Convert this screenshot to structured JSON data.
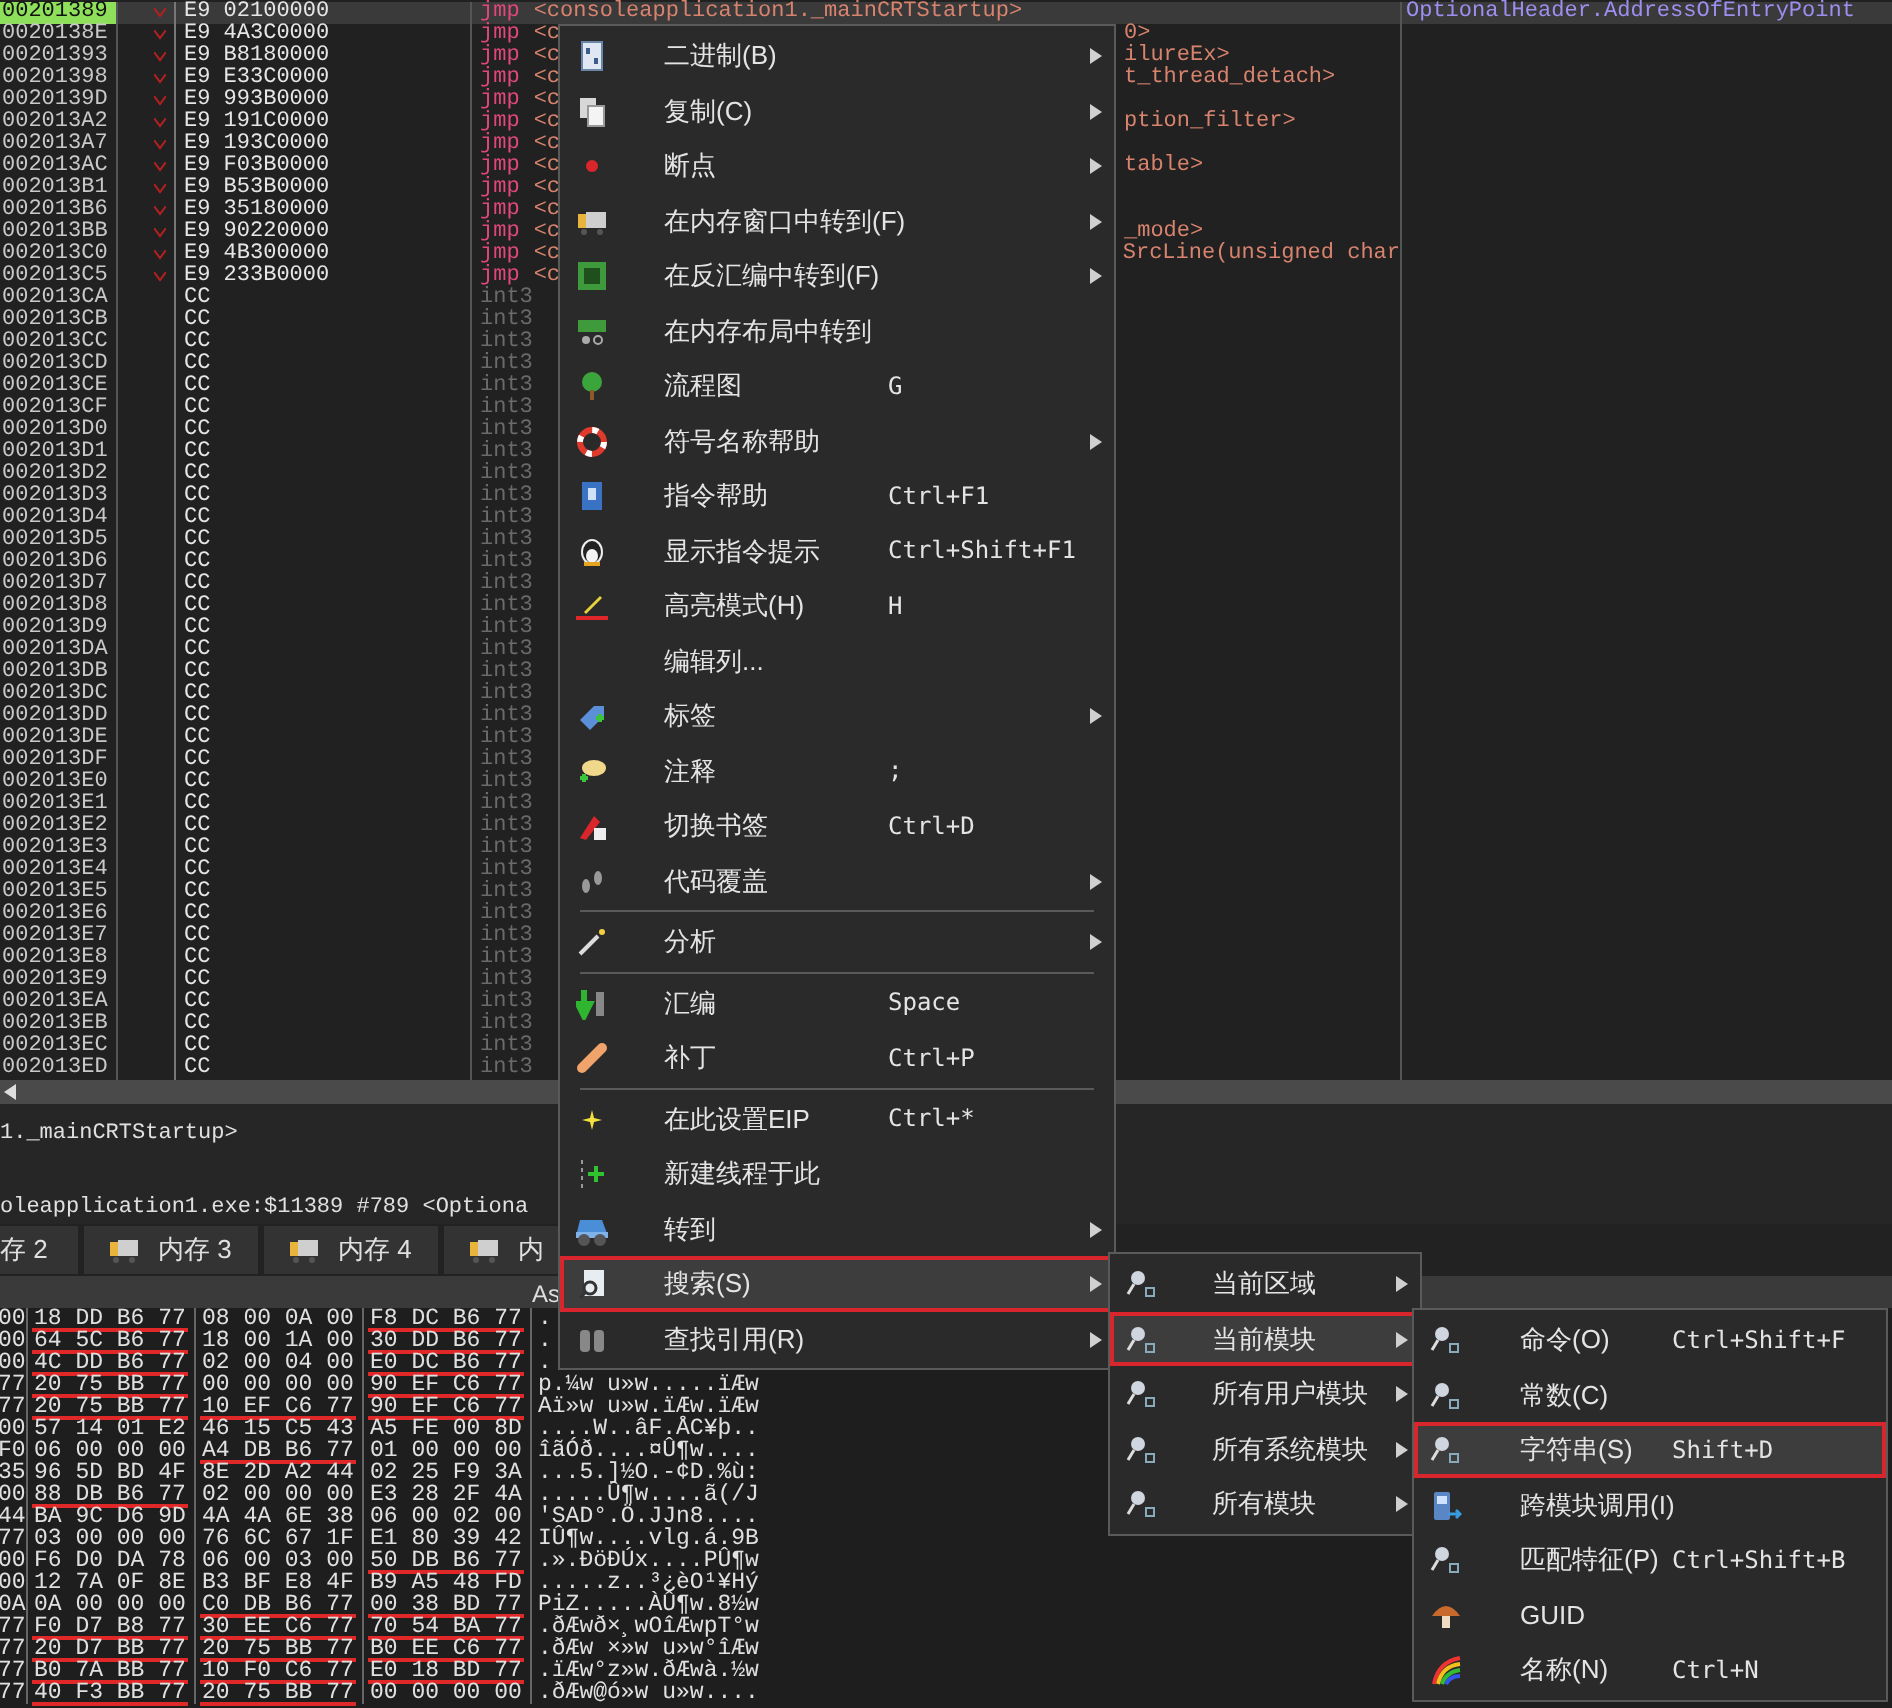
{
  "disassembly": {
    "rows": [
      {
        "kind": "jmp",
        "selected": true,
        "address": "00201389",
        "bytes": "E9 02100000",
        "mnemonic": "jmp",
        "operand": "<consoleapplication1._mainCRTStartup>",
        "comment": "OptionalHeader.AddressOfEntryPoint"
      },
      {
        "kind": "jmp",
        "selected": false,
        "address": "0020138E",
        "bytes": "E9 4A3C0000",
        "mnemonic": "jmp",
        "operand": "<c",
        "operand_tail": "0>"
      },
      {
        "kind": "jmp",
        "selected": false,
        "address": "00201393",
        "bytes": "E9 B8180000",
        "mnemonic": "jmp",
        "operand": "<c",
        "operand_tail": "ilureEx>"
      },
      {
        "kind": "jmp",
        "selected": false,
        "address": "00201398",
        "bytes": "E9 E33C0000",
        "mnemonic": "jmp",
        "operand": "<c",
        "operand_tail": "t_thread_detach>"
      },
      {
        "kind": "jmp",
        "selected": false,
        "address": "0020139D",
        "bytes": "E9 993B0000",
        "mnemonic": "jmp",
        "operand": "<c"
      },
      {
        "kind": "jmp",
        "selected": false,
        "address": "002013A2",
        "bytes": "E9 191C0000",
        "mnemonic": "jmp",
        "operand": "<c",
        "operand_tail": "ption_filter>"
      },
      {
        "kind": "jmp",
        "selected": false,
        "address": "002013A7",
        "bytes": "E9 193C0000",
        "mnemonic": "jmp",
        "operand": "<c"
      },
      {
        "kind": "jmp",
        "selected": false,
        "address": "002013AC",
        "bytes": "E9 F03B0000",
        "mnemonic": "jmp",
        "operand": "<c",
        "operand_tail": "table>"
      },
      {
        "kind": "jmp",
        "selected": false,
        "address": "002013B1",
        "bytes": "E9 B53B0000",
        "mnemonic": "jmp",
        "operand": "<c"
      },
      {
        "kind": "jmp",
        "selected": false,
        "address": "002013B6",
        "bytes": "E9 35180000",
        "mnemonic": "jmp",
        "operand": "<c"
      },
      {
        "kind": "jmp",
        "selected": false,
        "address": "002013BB",
        "bytes": "E9 90220000",
        "mnemonic": "jmp",
        "operand": "<c",
        "operand_tail": "_mode>"
      },
      {
        "kind": "jmp",
        "selected": false,
        "address": "002013C0",
        "bytes": "E9 4B300000",
        "mnemonic": "jmp",
        "operand": "<c",
        "operand_tail": "SrcLine(unsigned char"
      },
      {
        "kind": "jmp",
        "selected": false,
        "address": "002013C5",
        "bytes": "E9 233B0000",
        "mnemonic": "jmp",
        "operand": "<c"
      },
      {
        "kind": "int3",
        "selected": false,
        "address": "002013CA",
        "bytes": "CC",
        "mnemonic": "int3"
      },
      {
        "kind": "int3",
        "selected": false,
        "address": "002013CB",
        "bytes": "CC",
        "mnemonic": "int3"
      },
      {
        "kind": "int3",
        "selected": false,
        "address": "002013CC",
        "bytes": "CC",
        "mnemonic": "int3"
      },
      {
        "kind": "int3",
        "selected": false,
        "address": "002013CD",
        "bytes": "CC",
        "mnemonic": "int3"
      },
      {
        "kind": "int3",
        "selected": false,
        "address": "002013CE",
        "bytes": "CC",
        "mnemonic": "int3"
      },
      {
        "kind": "int3",
        "selected": false,
        "address": "002013CF",
        "bytes": "CC",
        "mnemonic": "int3"
      },
      {
        "kind": "int3",
        "selected": false,
        "address": "002013D0",
        "bytes": "CC",
        "mnemonic": "int3"
      },
      {
        "kind": "int3",
        "selected": false,
        "address": "002013D1",
        "bytes": "CC",
        "mnemonic": "int3"
      },
      {
        "kind": "int3",
        "selected": false,
        "address": "002013D2",
        "bytes": "CC",
        "mnemonic": "int3"
      },
      {
        "kind": "int3",
        "selected": false,
        "address": "002013D3",
        "bytes": "CC",
        "mnemonic": "int3"
      },
      {
        "kind": "int3",
        "selected": false,
        "address": "002013D4",
        "bytes": "CC",
        "mnemonic": "int3"
      },
      {
        "kind": "int3",
        "selected": false,
        "address": "002013D5",
        "bytes": "CC",
        "mnemonic": "int3"
      },
      {
        "kind": "int3",
        "selected": false,
        "address": "002013D6",
        "bytes": "CC",
        "mnemonic": "int3"
      },
      {
        "kind": "int3",
        "selected": false,
        "address": "002013D7",
        "bytes": "CC",
        "mnemonic": "int3"
      },
      {
        "kind": "int3",
        "selected": false,
        "address": "002013D8",
        "bytes": "CC",
        "mnemonic": "int3"
      },
      {
        "kind": "int3",
        "selected": false,
        "address": "002013D9",
        "bytes": "CC",
        "mnemonic": "int3"
      },
      {
        "kind": "int3",
        "selected": false,
        "address": "002013DA",
        "bytes": "CC",
        "mnemonic": "int3"
      },
      {
        "kind": "int3",
        "selected": false,
        "address": "002013DB",
        "bytes": "CC",
        "mnemonic": "int3"
      },
      {
        "kind": "int3",
        "selected": false,
        "address": "002013DC",
        "bytes": "CC",
        "mnemonic": "int3"
      },
      {
        "kind": "int3",
        "selected": false,
        "address": "002013DD",
        "bytes": "CC",
        "mnemonic": "int3"
      },
      {
        "kind": "int3",
        "selected": false,
        "address": "002013DE",
        "bytes": "CC",
        "mnemonic": "int3"
      },
      {
        "kind": "int3",
        "selected": false,
        "address": "002013DF",
        "bytes": "CC",
        "mnemonic": "int3"
      },
      {
        "kind": "int3",
        "selected": false,
        "address": "002013E0",
        "bytes": "CC",
        "mnemonic": "int3"
      },
      {
        "kind": "int3",
        "selected": false,
        "address": "002013E1",
        "bytes": "CC",
        "mnemonic": "int3"
      },
      {
        "kind": "int3",
        "selected": false,
        "address": "002013E2",
        "bytes": "CC",
        "mnemonic": "int3"
      },
      {
        "kind": "int3",
        "selected": false,
        "address": "002013E3",
        "bytes": "CC",
        "mnemonic": "int3"
      },
      {
        "kind": "int3",
        "selected": false,
        "address": "002013E4",
        "bytes": "CC",
        "mnemonic": "int3"
      },
      {
        "kind": "int3",
        "selected": false,
        "address": "002013E5",
        "bytes": "CC",
        "mnemonic": "int3"
      },
      {
        "kind": "int3",
        "selected": false,
        "address": "002013E6",
        "bytes": "CC",
        "mnemonic": "int3"
      },
      {
        "kind": "int3",
        "selected": false,
        "address": "002013E7",
        "bytes": "CC",
        "mnemonic": "int3"
      },
      {
        "kind": "int3",
        "selected": false,
        "address": "002013E8",
        "bytes": "CC",
        "mnemonic": "int3"
      },
      {
        "kind": "int3",
        "selected": false,
        "address": "002013E9",
        "bytes": "CC",
        "mnemonic": "int3"
      },
      {
        "kind": "int3",
        "selected": false,
        "address": "002013EA",
        "bytes": "CC",
        "mnemonic": "int3"
      },
      {
        "kind": "int3",
        "selected": false,
        "address": "002013EB",
        "bytes": "CC",
        "mnemonic": "int3"
      },
      {
        "kind": "int3",
        "selected": false,
        "address": "002013EC",
        "bytes": "CC",
        "mnemonic": "int3"
      },
      {
        "kind": "int3",
        "selected": false,
        "address": "002013ED",
        "bytes": "CC",
        "mnemonic": "int3"
      }
    ]
  },
  "info_lines": [
    "1._mainCRTStartup>",
    "oleapplication1.exe:$11389 #789 <Optiona"
  ],
  "memory_tabs": [
    {
      "label": "存 2",
      "selected": false
    },
    {
      "label": "内存 3",
      "selected": false
    },
    {
      "label": "内存 4",
      "selected": false
    },
    {
      "label": "内",
      "selected": false
    }
  ],
  "dump": {
    "ascii_header": "As",
    "rows": [
      {
        "edge": "00",
        "groups": [
          {
            "bytes": "18 DD B6 77",
            "pointer": true
          },
          {
            "bytes": "08 00 0A 00",
            "pointer": false
          },
          {
            "bytes": "F8 DC B6 77",
            "pointer": true
          }
        ],
        "ascii": "."
      },
      {
        "edge": "00",
        "groups": [
          {
            "bytes": "64 5C B6 77",
            "pointer": true
          },
          {
            "bytes": "18 00 1A 00",
            "pointer": false
          },
          {
            "bytes": "30 DD B6 77",
            "pointer": true
          }
        ],
        "ascii": "."
      },
      {
        "edge": "00",
        "groups": [
          {
            "bytes": "4C DD B6 77",
            "pointer": true
          },
          {
            "bytes": "02 00 04 00",
            "pointer": false
          },
          {
            "bytes": "E0 DC B6 77",
            "pointer": true
          }
        ],
        "ascii": "."
      },
      {
        "edge": "77",
        "groups": [
          {
            "bytes": "20 75 BB 77",
            "pointer": true
          },
          {
            "bytes": "00 00 00 00",
            "pointer": false
          },
          {
            "bytes": "90 EF C6 77",
            "pointer": true
          }
        ],
        "ascii": "p.¼w u»w.....ïÆw"
      },
      {
        "edge": "77",
        "groups": [
          {
            "bytes": "20 75 BB 77",
            "pointer": true
          },
          {
            "bytes": "10 EF C6 77",
            "pointer": true
          },
          {
            "bytes": "90 EF C6 77",
            "pointer": true
          }
        ],
        "ascii": "Aï»w u»w.ïÆw.ïÆw"
      },
      {
        "edge": "00",
        "groups": [
          {
            "bytes": "57 14 01 E2",
            "pointer": false
          },
          {
            "bytes": "46 15 C5 43",
            "pointer": false
          },
          {
            "bytes": "A5 FE 00 8D",
            "pointer": false
          }
        ],
        "ascii": "....W..âF.ÅC¥þ.."
      },
      {
        "edge": "F0",
        "groups": [
          {
            "bytes": "06 00 00 00",
            "pointer": false
          },
          {
            "bytes": "A4 DB B6 77",
            "pointer": true
          },
          {
            "bytes": "01 00 00 00",
            "pointer": false
          }
        ],
        "ascii": "îãÓð....¤Û¶w...."
      },
      {
        "edge": "35",
        "groups": [
          {
            "bytes": "96 5D BD 4F",
            "pointer": false
          },
          {
            "bytes": "8E 2D A2 44",
            "pointer": false
          },
          {
            "bytes": "02 25 F9 3A",
            "pointer": false
          }
        ],
        "ascii": "...5.]½O.-¢D.%ù:"
      },
      {
        "edge": "00",
        "groups": [
          {
            "bytes": "88 DB B6 77",
            "pointer": true
          },
          {
            "bytes": "02 00 00 00",
            "pointer": false
          },
          {
            "bytes": "E3 28 2F 4A",
            "pointer": false
          }
        ],
        "ascii": ".....Û¶w....ã(/J"
      },
      {
        "edge": "44",
        "groups": [
          {
            "bytes": "BA 9C D6 9D",
            "pointer": false
          },
          {
            "bytes": "4A 4A 6E 38",
            "pointer": false
          },
          {
            "bytes": "06 00 02 00",
            "pointer": false
          }
        ],
        "ascii": "'SAD°.Ö.JJn8...."
      },
      {
        "edge": "77",
        "groups": [
          {
            "bytes": "03 00 00 00",
            "pointer": false
          },
          {
            "bytes": "76 6C 67 1F",
            "pointer": false
          },
          {
            "bytes": "E1 80 39 42",
            "pointer": false
          }
        ],
        "ascii": "IÛ¶w....vlg.á.9B"
      },
      {
        "edge": "00",
        "groups": [
          {
            "bytes": "F6 D0 DA 78",
            "pointer": false
          },
          {
            "bytes": "06 00 03 00",
            "pointer": false
          },
          {
            "bytes": "50 DB B6 77",
            "pointer": true
          }
        ],
        "ascii": ".».ÐöÐÚx....PÛ¶w"
      },
      {
        "edge": "00",
        "groups": [
          {
            "bytes": "12 7A 0F 8E",
            "pointer": false
          },
          {
            "bytes": "B3 BF E8 4F",
            "pointer": false
          },
          {
            "bytes": "B9 A5 48 FD",
            "pointer": false
          }
        ],
        "ascii": ".....z..³¿èO¹¥Hý"
      },
      {
        "edge": "0A",
        "groups": [
          {
            "bytes": "0A 00 00 00",
            "pointer": false
          },
          {
            "bytes": "C0 DB B6 77",
            "pointer": true
          },
          {
            "bytes": "00 38 BD 77",
            "pointer": true
          }
        ],
        "ascii": "PiZ.....ÀÛ¶w.8½w"
      },
      {
        "edge": "77",
        "groups": [
          {
            "bytes": "F0 D7 B8 77",
            "pointer": true
          },
          {
            "bytes": "30 EE C6 77",
            "pointer": true
          },
          {
            "bytes": "70 54 BA 77",
            "pointer": true
          }
        ],
        "ascii": ".ðÆwð×¸wOîÆwpT°w"
      },
      {
        "edge": "77",
        "groups": [
          {
            "bytes": "20 D7 BB 77",
            "pointer": true
          },
          {
            "bytes": "20 75 BB 77",
            "pointer": true
          },
          {
            "bytes": "B0 EE C6 77",
            "pointer": true
          }
        ],
        "ascii": ".ðÆw ×»w u»w°îÆw"
      },
      {
        "edge": "77",
        "groups": [
          {
            "bytes": "B0 7A BB 77",
            "pointer": true
          },
          {
            "bytes": "10 F0 C6 77",
            "pointer": true
          },
          {
            "bytes": "E0 18 BD 77",
            "pointer": true
          }
        ],
        "ascii": ".ïÆw°z»w.ðÆwà.½w"
      },
      {
        "edge": "77",
        "groups": [
          {
            "bytes": "40 F3 BB 77",
            "pointer": true
          },
          {
            "bytes": "20 75 BB 77",
            "pointer": true
          },
          {
            "bytes": "00 00 00 00",
            "pointer": false
          }
        ],
        "ascii": ".ðÆw@ó»w u»w...."
      }
    ]
  },
  "context_menu": {
    "items": [
      {
        "kind": "item",
        "label": "二进制(B)",
        "submenu": true,
        "selected": false
      },
      {
        "kind": "item",
        "label": "复制(C)",
        "submenu": true,
        "selected": false
      },
      {
        "kind": "item",
        "label": "断点",
        "submenu": true,
        "selected": false
      },
      {
        "kind": "item",
        "label": "在内存窗口中转到(F)",
        "submenu": true,
        "selected": false
      },
      {
        "kind": "item",
        "label": "在反汇编中转到(F)",
        "submenu": true,
        "selected": false
      },
      {
        "kind": "item",
        "label": "在内存布局中转到",
        "submenu": false,
        "selected": false
      },
      {
        "kind": "item",
        "label": "流程图",
        "shortcut": "G",
        "submenu": false,
        "selected": false
      },
      {
        "kind": "item",
        "label": "符号名称帮助",
        "submenu": true,
        "selected": false
      },
      {
        "kind": "item",
        "label": "指令帮助",
        "shortcut": "Ctrl+F1",
        "submenu": false,
        "selected": false
      },
      {
        "kind": "item",
        "label": "显示指令提示",
        "shortcut": "Ctrl+Shift+F1",
        "submenu": false,
        "selected": false
      },
      {
        "kind": "item",
        "label": "高亮模式(H)",
        "shortcut": "H",
        "submenu": false,
        "selected": false
      },
      {
        "kind": "item",
        "label": "编辑列...",
        "submenu": false,
        "selected": false
      },
      {
        "kind": "item",
        "label": "标签",
        "submenu": true,
        "selected": false
      },
      {
        "kind": "item",
        "label": "注释",
        "shortcut": ";",
        "submenu": false,
        "selected": false
      },
      {
        "kind": "item",
        "label": "切换书签",
        "shortcut": "Ctrl+D",
        "submenu": false,
        "selected": false
      },
      {
        "kind": "item",
        "label": "代码覆盖",
        "submenu": true,
        "selected": false
      },
      {
        "kind": "separator"
      },
      {
        "kind": "item",
        "label": "分析",
        "submenu": true,
        "selected": false
      },
      {
        "kind": "separator"
      },
      {
        "kind": "item",
        "label": "汇编",
        "shortcut": "Space",
        "submenu": false,
        "selected": false
      },
      {
        "kind": "item",
        "label": "补丁",
        "shortcut": "Ctrl+P",
        "submenu": false,
        "selected": false
      },
      {
        "kind": "separator"
      },
      {
        "kind": "item",
        "label": "在此设置EIP",
        "shortcut": "Ctrl+*",
        "submenu": false,
        "selected": false
      },
      {
        "kind": "item",
        "label": "新建线程于此",
        "submenu": false,
        "selected": false
      },
      {
        "kind": "item",
        "label": "转到",
        "submenu": true,
        "selected": false
      },
      {
        "kind": "item",
        "label": "搜索(S)",
        "submenu": true,
        "selected": true
      },
      {
        "kind": "item",
        "label": "查找引用(R)",
        "submenu": true,
        "selected": false
      }
    ]
  },
  "search_submenu": {
    "items": [
      {
        "label": "当前区域",
        "submenu": true,
        "selected": false
      },
      {
        "label": "当前模块",
        "submenu": true,
        "selected": true
      },
      {
        "label": "所有用户模块",
        "submenu": true,
        "selected": false
      },
      {
        "label": "所有系统模块",
        "submenu": true,
        "selected": false
      },
      {
        "label": "所有模块",
        "submenu": true,
        "selected": false
      }
    ]
  },
  "module_submenu": {
    "items": [
      {
        "label": "命令(O)",
        "shortcut": "Ctrl+Shift+F",
        "selected": false
      },
      {
        "label": "常数(C)",
        "selected": false
      },
      {
        "label": "字符串(S)",
        "shortcut": "Shift+D",
        "selected": true
      },
      {
        "label": "跨模块调用(I)",
        "selected": false
      },
      {
        "label": "匹配特征(P)",
        "shortcut": "Ctrl+Shift+B",
        "selected": false
      },
      {
        "label": "GUID",
        "selected": false
      },
      {
        "label": "名称(N)",
        "shortcut": "Ctrl+N",
        "selected": false
      }
    ]
  }
}
